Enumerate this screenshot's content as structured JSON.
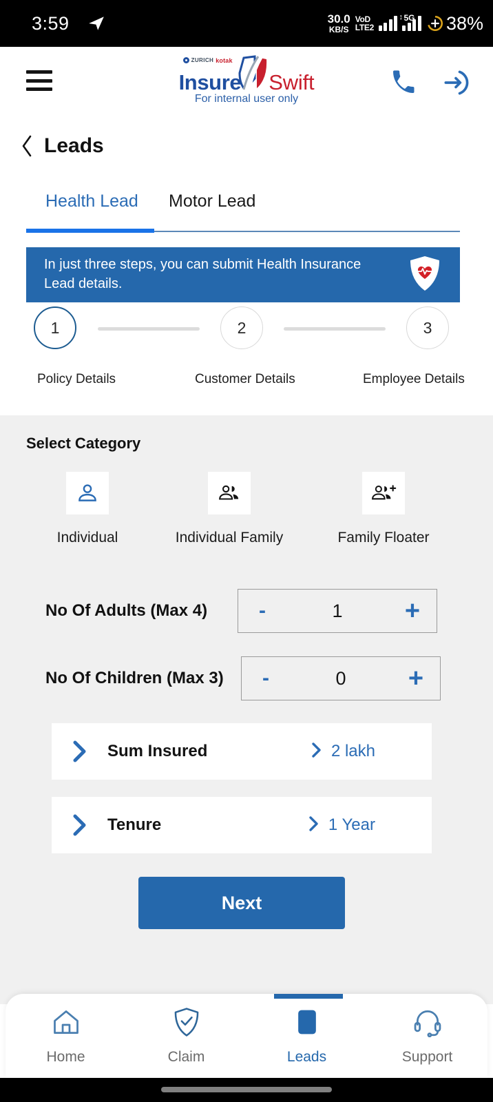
{
  "status_bar": {
    "time": "3:59",
    "send_icon": "telegram-send-icon",
    "network_speed_value": "30.0",
    "network_speed_unit": "KB/S",
    "volte_line1": "VoD",
    "volte_line2": "LTE2",
    "network_type": "5G",
    "battery_percent": "38%"
  },
  "header": {
    "menu_icon": "hamburger-menu-icon",
    "logo_brand_zurich": "ZURICH",
    "logo_brand_kotak": "kotak",
    "logo_primary": "Insure",
    "logo_secondary": "Swift",
    "tagline": "For internal user only",
    "call_icon": "phone-icon",
    "logout_icon": "logout-arrow-icon"
  },
  "page": {
    "back_icon": "back-chevron-icon",
    "title": "Leads"
  },
  "tabs": {
    "items": [
      {
        "label": "Health Lead",
        "active": true
      },
      {
        "label": "Motor Lead",
        "active": false
      }
    ]
  },
  "banner": {
    "text": "In just three steps, you can submit Health Insurance Lead details.",
    "icon": "health-shield-icon",
    "bg_color": "#2568ac"
  },
  "stepper": {
    "steps": [
      {
        "number": "1",
        "label": "Policy Details",
        "active": true
      },
      {
        "number": "2",
        "label": "Customer Details",
        "active": false
      },
      {
        "number": "3",
        "label": "Employee Details",
        "active": false
      }
    ],
    "active_color": "#1d5c91",
    "idle_color": "#d8d8d8"
  },
  "form": {
    "section_title": "Select Category",
    "categories": [
      {
        "label": "Individual",
        "icon": "person-icon",
        "selected": true
      },
      {
        "label": "Individual Family",
        "icon": "people-group-icon",
        "selected": false
      },
      {
        "label": "Family Floater",
        "icon": "people-group-add-icon",
        "selected": false
      }
    ],
    "adults": {
      "label": "No Of Adults (Max 4)",
      "value": "1",
      "minus_label": "-",
      "plus_label": "+"
    },
    "children": {
      "label": "No Of Children (Max 3)",
      "value": "0",
      "minus_label": "-",
      "plus_label": "+"
    },
    "options": [
      {
        "label": "Sum Insured",
        "value": "2 lakh",
        "icon": "chevron-right-icon"
      },
      {
        "label": "Tenure",
        "value": "1 Year",
        "icon": "chevron-right-icon"
      }
    ],
    "next_button": "Next"
  },
  "bottom_nav": {
    "items": [
      {
        "label": "Home",
        "icon": "home-icon",
        "active": false
      },
      {
        "label": "Claim",
        "icon": "shield-check-icon",
        "active": false
      },
      {
        "label": "Leads",
        "icon": "leads-icon",
        "active": true
      },
      {
        "label": "Support",
        "icon": "headset-icon",
        "active": false
      }
    ],
    "accent_color": "#2568ac"
  }
}
